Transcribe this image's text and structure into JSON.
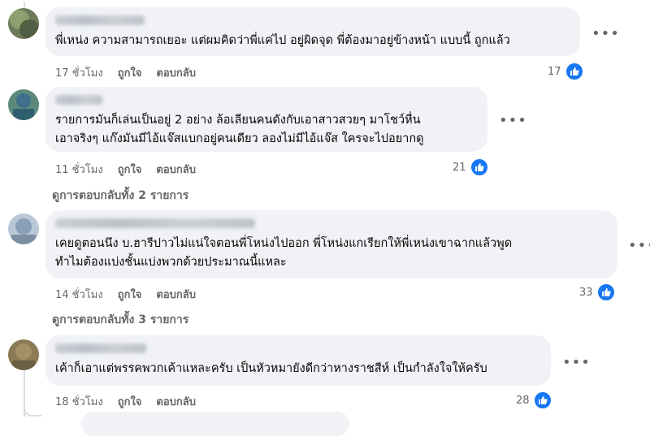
{
  "comments": [
    {
      "text": "พี่เหน่ง ความสามารถเยอะ แต่ผมคิดว่าพี่แค่ไป อยู่ผิดจุด พี่ต้องมาอยู่ข้างหน้า แบบนี้ ถูกแล้ว",
      "time": "17 ชั่วโมง",
      "like_label": "ถูกใจ",
      "reply_label": "ตอบกลับ",
      "reactions": "17"
    },
    {
      "text": "รายการมันก็เล่นเป็นอยู่ 2 อย่าง ล้อเลียนคนดังกับเอาสาวสวยๆ มาโชว์หื่น\nเอาจริงๆ แก๊งมันมีไอ้แจ๊สแบกอยู่คนเดียว ลองไม่มีไอ้แจ๊ส ใครจะไปอยากดู",
      "time": "11 ชั่วโมง",
      "like_label": "ถูกใจ",
      "reply_label": "ตอบกลับ",
      "reactions": "21",
      "view_replies": "ดูการตอบกลับทั้ง 2 รายการ"
    },
    {
      "text": "เคยดูตอนนึง บ.ฮารีปาวไม่แน่ใจตอนพี่โหน่งไปออก พี่โหน่งแกเรียกให้พี่เหน่งเขาฉากแล้วพูด\nทำไมต้องแบ่งชั้นแบ่งพวกด้วยประมาณนี้แหละ",
      "time": "14 ชั่วโมง",
      "like_label": "ถูกใจ",
      "reply_label": "ตอบกลับ",
      "reactions": "33",
      "view_replies": "ดูการตอบกลับทั้ง 3 รายการ"
    },
    {
      "text": "เค้าก็เอาแต่พรรคพวกเค้าแหละครับ เป็นหัวหมายังดีกว่าหางราชสีห์ เป็นกำลังใจให้ครับ",
      "time": "18 ชั่วโมง",
      "like_label": "ถูกใจ",
      "reply_label": "ตอบกลับ",
      "reactions": "28"
    }
  ],
  "colors": {
    "bubble": "#f0f2f5",
    "meta": "#65676b",
    "like_blue": "#1877f2"
  }
}
